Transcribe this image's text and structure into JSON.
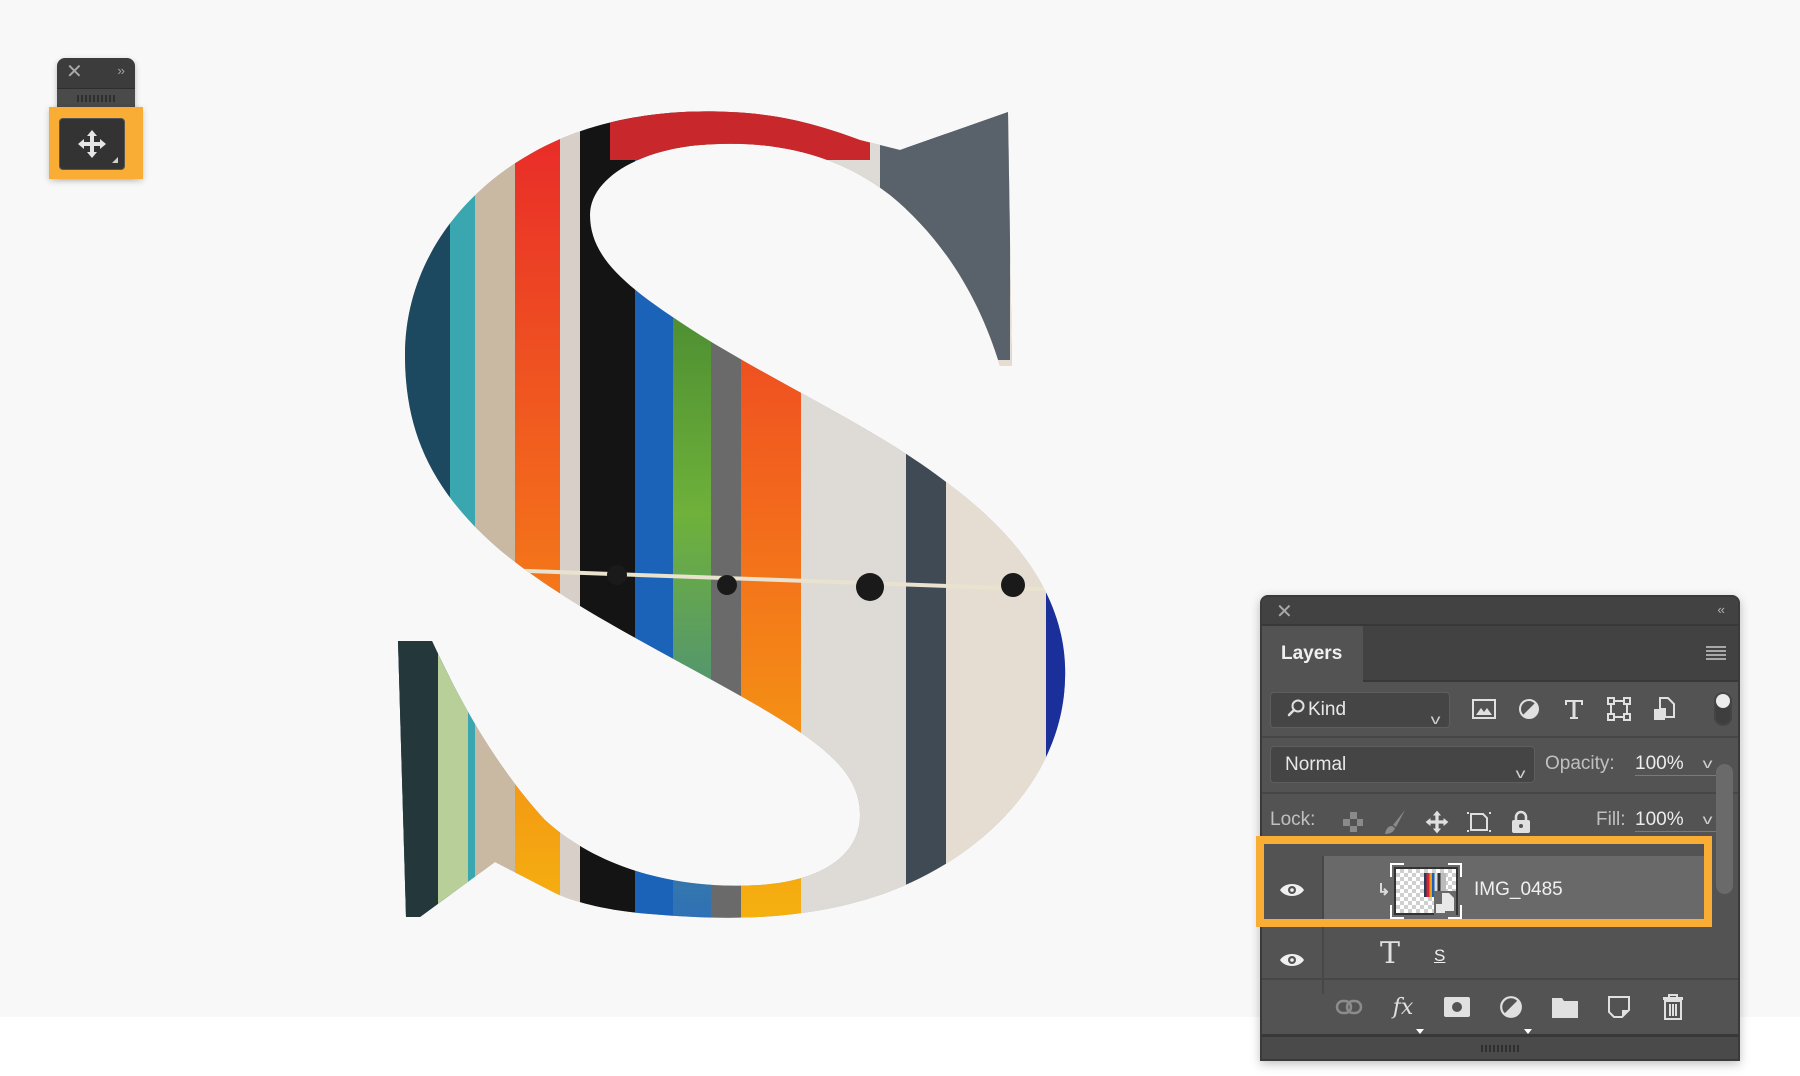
{
  "canvas": {
    "background": "#f8f8f8",
    "artwork_letter": "S",
    "artwork_description": "surfboards photo clipped to letter S"
  },
  "highlight_color": "#f9ad35",
  "tools_panel": {
    "close_icon": "close-icon",
    "expand_label": "››",
    "active_tool": "move-tool",
    "active_tool_icon": "move-icon"
  },
  "layers_panel": {
    "close_label": "✕",
    "collapse_label": "‹‹",
    "tab_label": "Layers",
    "menu_icon": "panel-menu-icon",
    "filter": {
      "kind_label": "Kind",
      "icons": [
        "image-filter-icon",
        "adjustment-filter-icon",
        "type-filter-icon",
        "shape-filter-icon",
        "smart-object-filter-icon"
      ],
      "toggle_on": true
    },
    "blend_mode": "Normal",
    "opacity_label": "Opacity:",
    "opacity_value": "100%",
    "lock_label": "Lock:",
    "lock_icons": [
      "lock-transparent-pixels-icon",
      "lock-image-pixels-icon",
      "lock-position-icon",
      "lock-artboard-icon",
      "lock-all-icon"
    ],
    "fill_label": "Fill:",
    "fill_value": "100%",
    "layers": [
      {
        "name": "IMG_0485",
        "type": "smart-object",
        "visible": true,
        "clipped": true,
        "selected": true
      },
      {
        "name": "S",
        "type": "text",
        "visible": true,
        "clipped": false,
        "selected": false
      }
    ],
    "footer_icons": [
      "link-layers-icon",
      "layer-style-fx-icon",
      "add-mask-icon",
      "adjustment-layer-icon",
      "new-group-icon",
      "new-layer-icon",
      "delete-layer-icon"
    ]
  }
}
